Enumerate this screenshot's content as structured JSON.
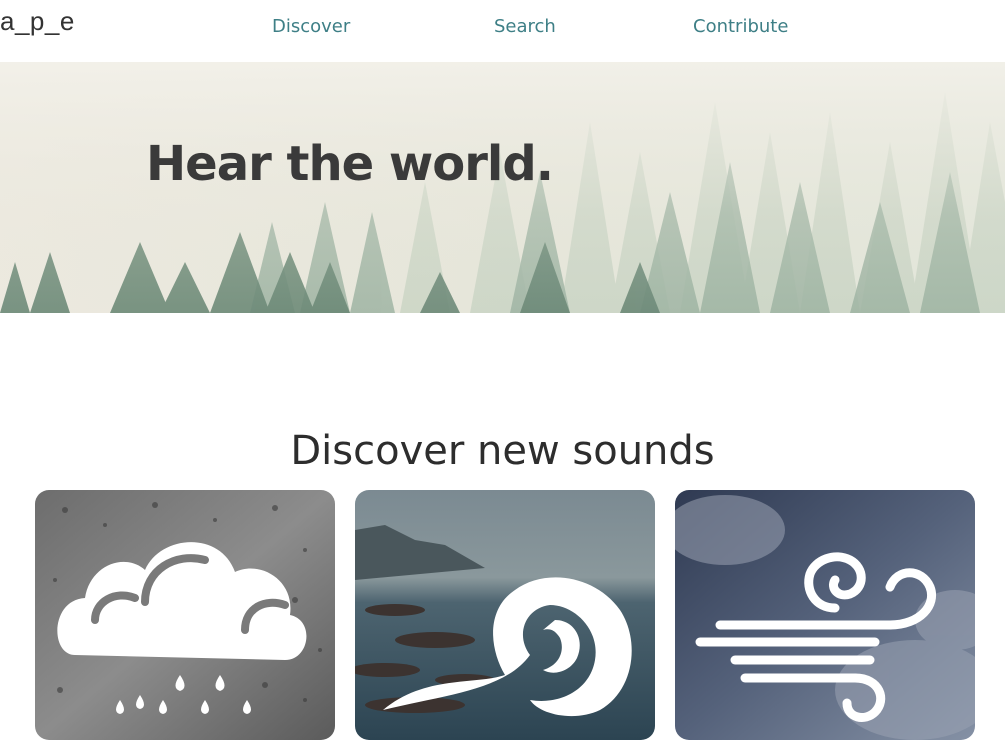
{
  "header": {
    "logo": "a_p_e",
    "nav": [
      {
        "label": "Discover"
      },
      {
        "label": "Search"
      },
      {
        "label": "Contribute"
      }
    ]
  },
  "hero": {
    "title": "Hear the world."
  },
  "discover": {
    "title": "Discover new sounds",
    "cards": [
      {
        "icon": "rain-cloud-icon"
      },
      {
        "icon": "ocean-wave-icon"
      },
      {
        "icon": "wind-icon"
      }
    ]
  },
  "colors": {
    "nav_link": "#3e7f86",
    "text_dark": "#2d2d2d",
    "hero_fog": "#e8ebe0"
  }
}
